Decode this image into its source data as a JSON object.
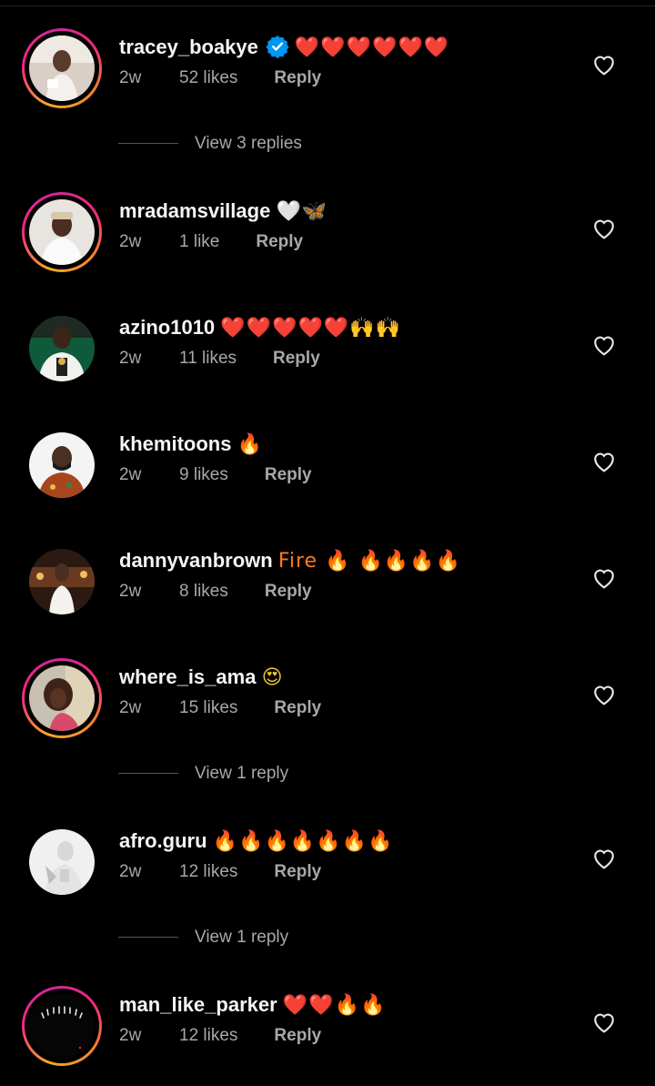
{
  "comments": [
    {
      "username": "tracey_boakye",
      "verified": true,
      "text": "❤️❤️❤️❤️❤️❤️",
      "time": "2w",
      "likes": "52 likes",
      "reply": "Reply",
      "ring": true
    },
    {
      "username": "mradamsvillage",
      "verified": false,
      "text": "🤍🦋",
      "time": "2w",
      "likes": "1 like",
      "reply": "Reply",
      "ring": true
    },
    {
      "username": "azino1010",
      "verified": false,
      "text": "❤️❤️❤️❤️❤️🙌🙌",
      "time": "2w",
      "likes": "11 likes",
      "reply": "Reply",
      "ring": false
    },
    {
      "username": "khemitoons",
      "verified": false,
      "text": "🔥",
      "time": "2w",
      "likes": "9 likes",
      "reply": "Reply",
      "ring": false
    },
    {
      "username": "dannyvanbrown",
      "verified": false,
      "text": "Fire 🔥 🔥🔥🔥🔥",
      "time": "2w",
      "likes": "8 likes",
      "reply": "Reply",
      "ring": false
    },
    {
      "username": "where_is_ama",
      "verified": false,
      "text": "😍",
      "time": "2w",
      "likes": "15 likes",
      "reply": "Reply",
      "ring": true
    },
    {
      "username": "afro.guru",
      "verified": false,
      "text": "🔥🔥🔥🔥🔥🔥🔥",
      "time": "2w",
      "likes": "12 likes",
      "reply": "Reply",
      "ring": false
    },
    {
      "username": "man_like_parker",
      "verified": false,
      "text": "❤️❤️🔥🔥",
      "time": "2w",
      "likes": "12 likes",
      "reply": "Reply",
      "ring": true
    }
  ],
  "view_replies": [
    "View 3 replies",
    "View 1 reply",
    "View 1 reply"
  ],
  "colors": {
    "background": "#000000",
    "secondary_text": "#a8a8a8",
    "verified_blue": "#0095f6"
  }
}
